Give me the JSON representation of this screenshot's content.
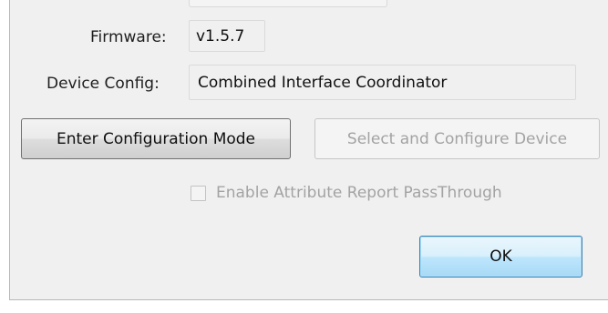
{
  "fields": {
    "firmware": {
      "label": "Firmware:",
      "value": "v1.5.7"
    },
    "device_config": {
      "label": "Device Config:",
      "value": "Combined Interface Coordinator"
    }
  },
  "buttons": {
    "enter_config": "Enter Configuration Mode",
    "select_configure": "Select and Configure Device",
    "ok": "OK"
  },
  "checkbox": {
    "label": "Enable Attribute Report PassThrough",
    "checked": false,
    "enabled": false
  }
}
